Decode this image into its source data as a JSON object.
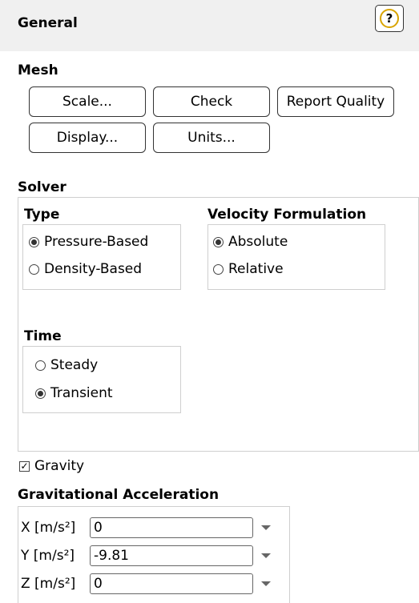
{
  "panel_title": "General",
  "mesh": {
    "section_label": "Mesh",
    "buttons": {
      "scale": "Scale...",
      "check": "Check",
      "report_quality": "Report Quality",
      "display": "Display...",
      "units": "Units..."
    }
  },
  "solver": {
    "section_label": "Solver",
    "type": {
      "label": "Type",
      "options": [
        "Pressure-Based",
        "Density-Based"
      ],
      "selected": "Pressure-Based"
    },
    "velocity_formulation": {
      "label": "Velocity Formulation",
      "options": [
        "Absolute",
        "Relative"
      ],
      "selected": "Absolute"
    },
    "time": {
      "label": "Time",
      "options": [
        "Steady",
        "Transient"
      ],
      "selected": "Transient"
    }
  },
  "gravity": {
    "label": "Gravity",
    "checked": true,
    "check_glyph": "✓"
  },
  "gravitational_acceleration": {
    "label": "Gravitational Acceleration",
    "fields": [
      {
        "label": "X [m/s²]",
        "value": "0"
      },
      {
        "label": "Y [m/s²]",
        "value": "-9.81"
      },
      {
        "label": "Z [m/s²]",
        "value": "0"
      }
    ]
  },
  "icons": {
    "help": "?"
  },
  "colors": {
    "header_bg": "#f0f0f0",
    "help_ring": "#d9a400"
  }
}
